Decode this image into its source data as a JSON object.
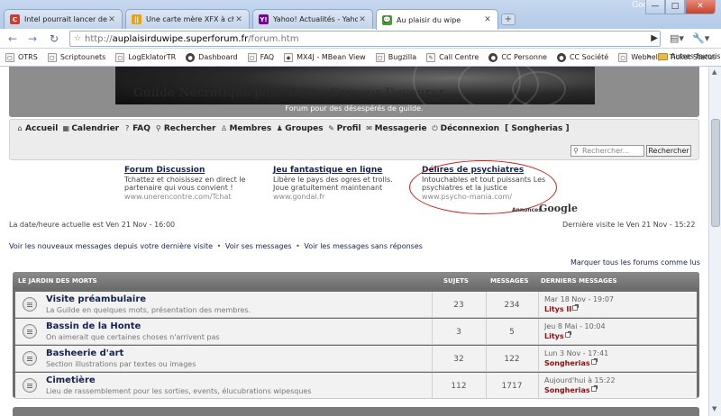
{
  "browser": {
    "tabs": [
      {
        "title": "Intel pourrait lancer des Co...",
        "favicon_color": "#d23b2b",
        "favicon_text": "C"
      },
      {
        "title": "Une carte mère XFX à chips...",
        "favicon_color": "#e8a317",
        "favicon_text": "||"
      },
      {
        "title": "Yahoo! Actualités - Yahoo! ...",
        "favicon_color": "#7b0099",
        "favicon_text": "Y!"
      },
      {
        "title": "Au plaisir du wipe",
        "favicon_color": "#4a9a3a",
        "favicon_text": "💬"
      }
    ],
    "new_tab": "+",
    "window_label": "Google",
    "window_buttons": {
      "minimize": "—",
      "maximize": "□",
      "close": "✕"
    },
    "nav": {
      "back": "←",
      "forward": "→",
      "reload": "↻",
      "star": "☆"
    },
    "url": {
      "prefix": "http://",
      "domain": "auplaisirduwipe.superforum.fr",
      "path": "/forum.htm"
    },
    "tools": {
      "go": "▶",
      "page": "▤▾",
      "wrench": "🔧▾"
    },
    "bookmarks": [
      {
        "label": "OTRS",
        "icon": "▢"
      },
      {
        "label": "Scriptounets",
        "icon": "▢"
      },
      {
        "label": "LogEklatorTR",
        "icon": "▢"
      },
      {
        "label": "Dashboard",
        "icon": "●"
      },
      {
        "label": "FAQ",
        "icon": "▢"
      },
      {
        "label": "MX4J - MBean View",
        "icon": "◆"
      },
      {
        "label": "Bugzilla",
        "icon": "▢"
      },
      {
        "label": "Call Centre",
        "icon": "✎"
      },
      {
        "label": "CC Personne",
        "icon": "●"
      },
      {
        "label": "CC Société",
        "icon": "●"
      },
      {
        "label": "Webhelp : Ticket Status",
        "icon": "▢"
      }
    ],
    "bookmarks_more": "»",
    "bookmarks_other": "Autres favoris"
  },
  "page": {
    "banner_title": "Guilde Nécrotique pour DDO - Serveur Devourer",
    "banner_subtitle": "Forum pour des désespérés de guilde.",
    "menu": [
      {
        "label": "Accueil",
        "icon": "⌂"
      },
      {
        "label": "Calendrier",
        "icon": "▦"
      },
      {
        "label": "FAQ",
        "icon": "?"
      },
      {
        "label": "Rechercher",
        "icon": "⚲"
      },
      {
        "label": "Membres",
        "icon": "♙"
      },
      {
        "label": "Groupes",
        "icon": "♟"
      },
      {
        "label": "Profil",
        "icon": "✎"
      },
      {
        "label": "Messagerie",
        "icon": "✉"
      },
      {
        "label": "Déconnexion",
        "icon": "⏻"
      }
    ],
    "menu_user": "[ Songherias ]",
    "search": {
      "placeholder": "Rechercher...",
      "button": "Rechercher"
    },
    "ads": [
      {
        "title": "Forum Discussion",
        "text": "Tchattez et choisissez en direct le partenaire qui vous convient !",
        "url": "www.unerencontre.com/Tchat"
      },
      {
        "title": "Jeu fantastique en ligne",
        "text": "Libère le pays des ogres et trolls. Joue gratuitement maintenant",
        "url": "www.gondal.fr"
      },
      {
        "title": "Délires de psychiatres",
        "text": "Intouchables et tout puissants Les psychiatres et la justice",
        "url": "www.psycho-mania.com/"
      }
    ],
    "ads_by": "Annonces",
    "ads_brand": "Google",
    "datetime": "La date/heure actuelle est Ven 21 Nov - 16:00",
    "last_visit": "Dernière visite le Ven 21 Nov - 15:22",
    "quick_links": [
      "Voir les nouveaux messages depuis votre dernière visite",
      "Voir ses messages",
      "Voir les messages sans réponses"
    ],
    "quick_sep": "•",
    "mark_read": "Marquer tous les forums comme lus"
  },
  "forum": {
    "category": "LE JARDIN DES MORTS",
    "columns": {
      "topics": "SUJETS",
      "posts": "MESSAGES",
      "last": "DERNIERS MESSAGES"
    },
    "rows": [
      {
        "name": "Visite préambulaire",
        "desc": "La Guilde en quelques mots, présentation des membres.",
        "topics": "23",
        "posts": "234",
        "last_date": "Mar 18 Nov - 19:07",
        "last_user": "Litys II"
      },
      {
        "name": "Bassin de la Honte",
        "desc": "On aimerait que certaines choses n'arrivent pas",
        "topics": "3",
        "posts": "5",
        "last_date": "Jeu 8 Mai - 10:04",
        "last_user": "Litys"
      },
      {
        "name": "Basheerie d'art",
        "desc": "Section illustrations par textes ou images",
        "topics": "32",
        "posts": "122",
        "last_date": "Lun 3 Nov - 17:41",
        "last_user": "Songherias"
      },
      {
        "name": "Cimetière",
        "desc": "Lieu de rassemblement pour les sorties, events, élucubrations wipesques",
        "topics": "112",
        "posts": "1717",
        "last_date": "Aujourd'hui à 15:22",
        "last_user": "Songherias"
      }
    ]
  }
}
